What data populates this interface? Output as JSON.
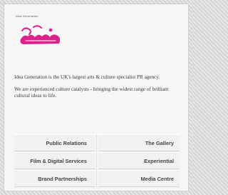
{
  "header": {
    "tagline": "Idea Generation",
    "logo_text": "Idea Generation"
  },
  "intro": {
    "paragraph_1": "Idea Generation is the UK's largest arts & culture specialist PR agency.",
    "paragraph_2": "We are experienced culture catalysts - bringing the widest range of brilliant cultural ideas to life."
  },
  "nav": {
    "items": [
      {
        "label": "Public Relations"
      },
      {
        "label": "The Gallery"
      },
      {
        "label": "Film & Digital Services"
      },
      {
        "label": "Experiential"
      },
      {
        "label": "Brand Partnerships"
      },
      {
        "label": "Media Centre"
      }
    ]
  },
  "colors": {
    "logo_pink": "#e0208a",
    "text": "#3a3a3a",
    "panel_background": "#f6f6f6"
  }
}
